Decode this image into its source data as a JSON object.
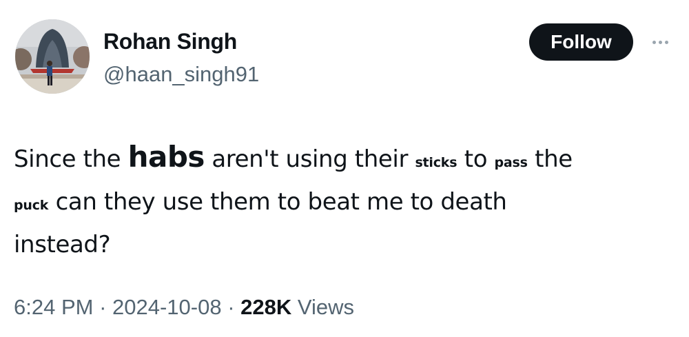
{
  "author": {
    "display_name": "Rohan Singh",
    "handle": "@haan_singh91",
    "avatar_icon": "profile-photo"
  },
  "actions": {
    "follow_label": "Follow",
    "more_icon": "more-horizontal-icon"
  },
  "tweet": {
    "line1": {
      "a": "Since the ",
      "b": "habs",
      "c": " aren't using their ",
      "d": "sticks",
      "e": " to ",
      "f": "pass",
      "g": " the"
    },
    "line2": {
      "a": "puck",
      "b": " can they use them to beat me to death"
    },
    "line3": "instead?"
  },
  "meta": {
    "time": "6:24 PM",
    "separator": " · ",
    "date": "2024-10-08",
    "views_count": "228K",
    "views_label": " Views"
  },
  "colors": {
    "text": "#0f1419",
    "secondary": "#536471",
    "button_bg": "#0f1419",
    "button_text": "#ffffff"
  }
}
